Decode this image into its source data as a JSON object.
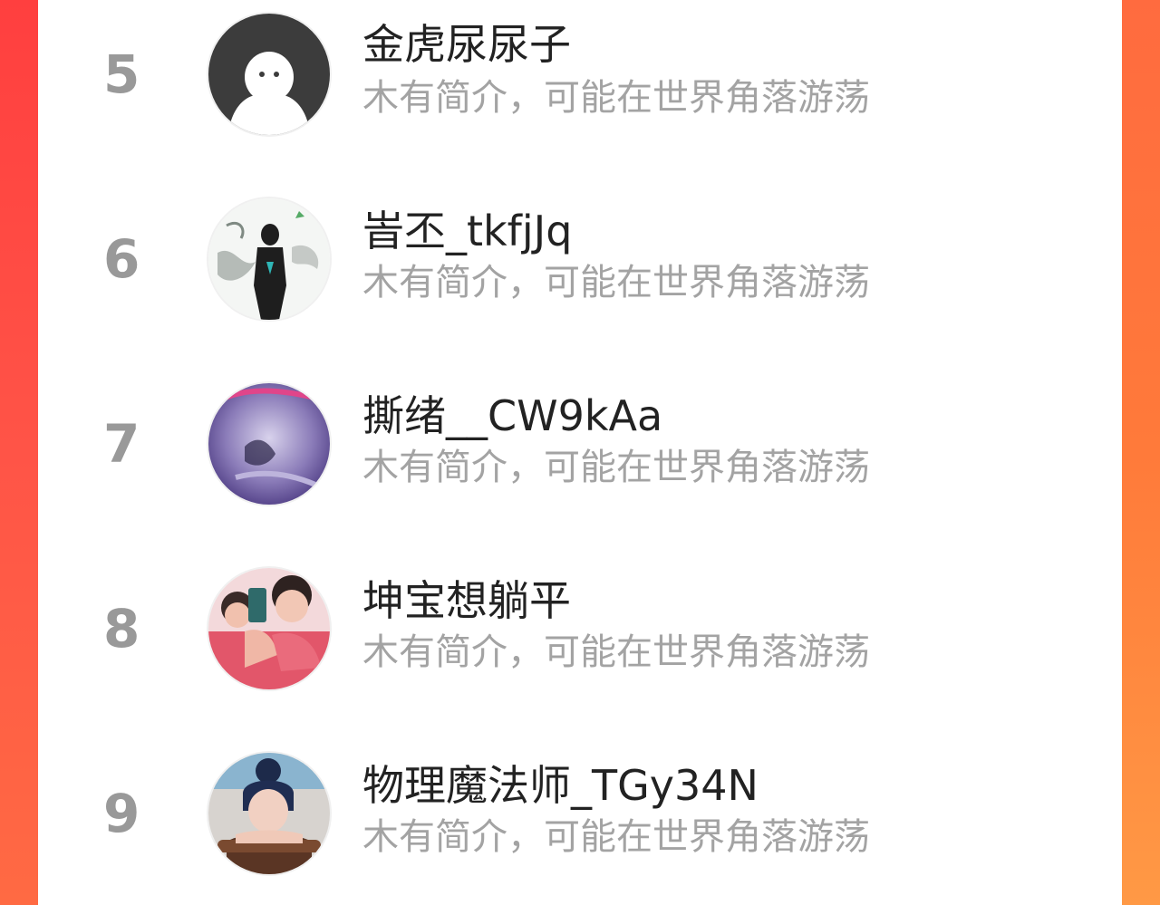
{
  "leaderboard": {
    "entries": [
      {
        "rank": "5",
        "name": "金虎尿尿子",
        "intro": "木有简介，可能在世界角落游荡",
        "avatar_icon": "default-ghost-avatar"
      },
      {
        "rank": "6",
        "name": "峕丕_tkfjJq",
        "intro": "木有简介，可能在世界角落游荡",
        "avatar_icon": "ink-silhouette-avatar"
      },
      {
        "rank": "7",
        "name": "撕绪__CW9kAa",
        "intro": "木有简介，可能在世界角落游荡",
        "avatar_icon": "purple-photo-avatar"
      },
      {
        "rank": "8",
        "name": "坤宝想躺平",
        "intro": "木有简介，可能在世界角落游荡",
        "avatar_icon": "selfie-photo-avatar"
      },
      {
        "rank": "9",
        "name": "物理魔法师_TGy34N",
        "intro": "木有简介，可能在世界角落游荡",
        "avatar_icon": "portrait-photo-avatar"
      }
    ]
  },
  "colors": {
    "background_accent": "#ff5a3c",
    "rank_text": "#999999",
    "name_text": "#222222",
    "intro_text": "#a3a3a3"
  }
}
